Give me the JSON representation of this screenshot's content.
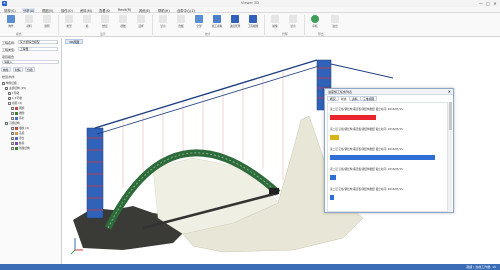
{
  "app": {
    "title": "Viewer 3D",
    "logo": "B"
  },
  "window": {
    "min": "—",
    "max": "□",
    "close": "✕"
  },
  "menu": [
    "常规(G)",
    "分析(A)",
    "视图(V)",
    "操作(O)",
    "资料(M)",
    "查看(S)",
    "Revit(R)",
    "其他(E)",
    "帮助(H)",
    "自带中心(Z)"
  ],
  "ribbon": {
    "buttons": [
      "构件",
      "材料",
      "规则",
      "类型",
      "族",
      "楼层",
      "视图",
      "选择",
      "显示",
      "隐藏",
      "全部",
      "施工模拟",
      "进度管理",
      "工程视图",
      "碰撞",
      "显示",
      "审核",
      "进出"
    ],
    "groups": [
      "模式",
      "显示",
      "统计",
      "管理",
      "导出"
    ]
  },
  "left_panel": {
    "project_name_label": "工程名称:",
    "project_name_value": "某大桥综合模型",
    "project_type_label": "工程类型:",
    "project_type_value": "工程量",
    "section_label": "项目组合",
    "search_placeholder": "请输入",
    "tabs": [
      "构件",
      "材料",
      "分组"
    ],
    "tree_title": "楼层/构件",
    "tree": [
      {
        "label": "构件层级",
        "color": ""
      },
      {
        "label": "主桥结构 (15)",
        "color": ""
      },
      {
        "label": "1号墩",
        "color": ""
      },
      {
        "label": "1-3号墩",
        "color": ""
      },
      {
        "label": "桥塔 (4)",
        "color": ""
      },
      {
        "label": "钢梁",
        "color": "#c24c4c"
      },
      {
        "label": "拱肋",
        "color": "#3b7f3b"
      },
      {
        "label": "吊杆",
        "color": "#4c6ec2"
      },
      {
        "label": "引桥结构",
        "color": ""
      },
      {
        "label": "墩柱 (4)",
        "color": "#c24c4c"
      },
      {
        "label": "盖梁",
        "color": "#c29a4c"
      },
      {
        "label": "承台",
        "color": "#4c6ec2"
      },
      {
        "label": "桩基",
        "color": "#7a4cc2"
      },
      {
        "label": "附属结构",
        "color": "#3b7f3b"
      }
    ]
  },
  "viewport": {
    "tab": "3D视图"
  },
  "dialog": {
    "title": "进度施工任务列表",
    "close": "✕",
    "tabs": [
      "概况",
      "状态",
      "资料",
      "三维视图"
    ],
    "tasks": [
      {
        "text": "第二层  钉板/钢结构  覆盖板/钢结构图纸  截止时间:  2016/05/15",
        "bar_color": "#e8262c",
        "progress": 0.42
      },
      {
        "text": "第二层  钉板/钢结构  覆盖板/钢结构图纸  截止时间:  2016/05/15",
        "bar_color": "#d9b414",
        "progress": 0.08
      },
      {
        "text": "第二层  钉板/钢结构  覆盖板/钢结构图纸  截止时间:  2016/05/15",
        "bar_color": "#2f6fd6",
        "progress": 0.95
      },
      {
        "text": "第二层  钉板/钢结构  覆盖板/钢结构图纸  截止时间:  2016/05/15",
        "bar_color": "#2f6fd6",
        "progress": 0.05
      },
      {
        "text": "第二层  钉板/钢结构  覆盖板/钢结构图纸  截止时间:  2016/05/15",
        "bar_color": "#2f6fd6",
        "progress": 0.04
      }
    ]
  },
  "status": {
    "text": "就绪  |  当前工作量: 15"
  },
  "colors": {
    "accent": "#3a6db5",
    "arch": "#2e6b3a",
    "tower": "#2f62b8"
  }
}
